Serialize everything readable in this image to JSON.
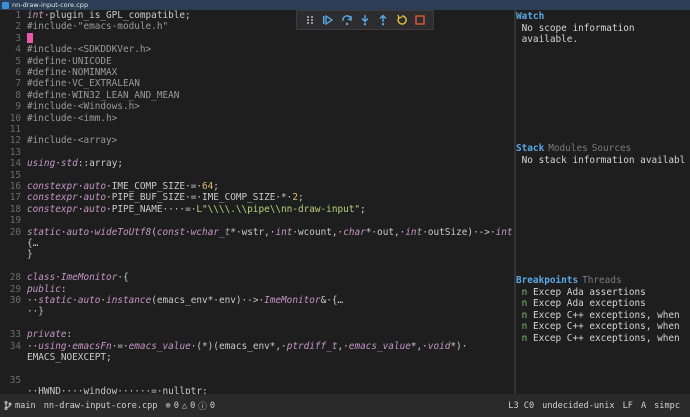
{
  "window": {
    "title": "nn-draw-input-core.cpp"
  },
  "editor": {
    "lines": [
      {
        "n": "1",
        "t": "int·plugin_is_GPL_compatible;"
      },
      {
        "n": "2",
        "t": "#include·\"emacs-module.h\""
      },
      {
        "n": "3",
        "t": ""
      },
      {
        "n": "4",
        "t": "#include·<SDKDDKVer.h>"
      },
      {
        "n": "5",
        "t": "#define·UNICODE"
      },
      {
        "n": "6",
        "t": "#define·NOMINMAX"
      },
      {
        "n": "7",
        "t": "#define·VC_EXTRALEAN"
      },
      {
        "n": "8",
        "t": "#define·WIN32_LEAN_AND_MEAN"
      },
      {
        "n": "9",
        "t": "#include·<Windows.h>"
      },
      {
        "n": "10",
        "t": "#include·<imm.h>"
      },
      {
        "n": "11",
        "t": ""
      },
      {
        "n": "12",
        "t": "#include·<array>"
      },
      {
        "n": "13",
        "t": ""
      },
      {
        "n": "14",
        "t": "using·std::array;"
      },
      {
        "n": "15",
        "t": ""
      },
      {
        "n": "16",
        "t": "constexpr·auto·IME_COMP_SIZE·=·64;"
      },
      {
        "n": "17",
        "t": "constexpr·auto·PIPE_BUF_SIZE·=·IME_COMP_SIZE·*·2;"
      },
      {
        "n": "18",
        "t": "constexpr·auto·PIPE_NAME····=·L\"\\\\\\\\.\\\\pipe\\\\nn-draw-input\";"
      },
      {
        "n": "19",
        "t": ""
      },
      {
        "n": "20",
        "t": "static·auto·wideToUtf8(const·wchar_t*·wstr,·int·wcount,·char*·out,·int·outSize)·->·int·"
      },
      {
        "n": "",
        "t": "{…"
      },
      {
        "n": "",
        "t": "}"
      },
      {
        "n": "",
        "t": ""
      },
      {
        "n": "28",
        "t": "class·ImeMonitor·{"
      },
      {
        "n": "29",
        "t": "public:"
      },
      {
        "n": "30",
        "t": "··static·auto·instance(emacs_env*·env)·->·ImeMonitor&·{…"
      },
      {
        "n": "",
        "t": "··}"
      },
      {
        "n": "",
        "t": ""
      },
      {
        "n": "33",
        "t": "private:"
      },
      {
        "n": "34",
        "t": "··using·emacsFn·=·emacs_value·(*)(emacs_env*,·ptrdiff_t,·emacs_value*,·void*)·"
      },
      {
        "n": "",
        "t": "EMACS_NOEXCEPT;"
      },
      {
        "n": "",
        "t": ""
      },
      {
        "n": "35",
        "t": ""
      },
      {
        "n": "",
        "t": "··HWND····window······=·nullptr;"
      }
    ]
  },
  "debug_toolbar": {
    "buttons": [
      "drag-handle",
      "continue",
      "step-over",
      "step-into",
      "step-out",
      "restart",
      "stop"
    ]
  },
  "watch": {
    "title": "Watch",
    "body": " No scope information\n available."
  },
  "stack": {
    "tabs": [
      "Stack",
      "Modules",
      "Sources"
    ],
    "body": " No stack information availabl $"
  },
  "breakpoints": {
    "tabs": [
      "Breakpoints",
      "Threads"
    ],
    "items": [
      {
        "flag": "n",
        "text": "Excep Ada assertions"
      },
      {
        "flag": "n",
        "text": "Excep Ada exceptions"
      },
      {
        "flag": "n",
        "text": "Excep C++ exceptions, when  $"
      },
      {
        "flag": "n",
        "text": "Excep C++ exceptions, when  $"
      },
      {
        "flag": "n",
        "text": "Excep C++ exceptions, when  $"
      }
    ]
  },
  "status": {
    "branch": "main",
    "file": "nn-draw-input-core.cpp",
    "errors": "0",
    "warnings": "0",
    "infos": "0",
    "position": "L3 C0",
    "encoding": "undecided-unix",
    "eol": "LF",
    "input": "A",
    "mode": "simpc"
  },
  "colors": {
    "accent": "#5aa9e6",
    "keyword": "#c594c5",
    "string": "#b7d17a",
    "cursor": "#e85aa8",
    "stop": "#e05a3a",
    "restart": "#e0c040"
  }
}
